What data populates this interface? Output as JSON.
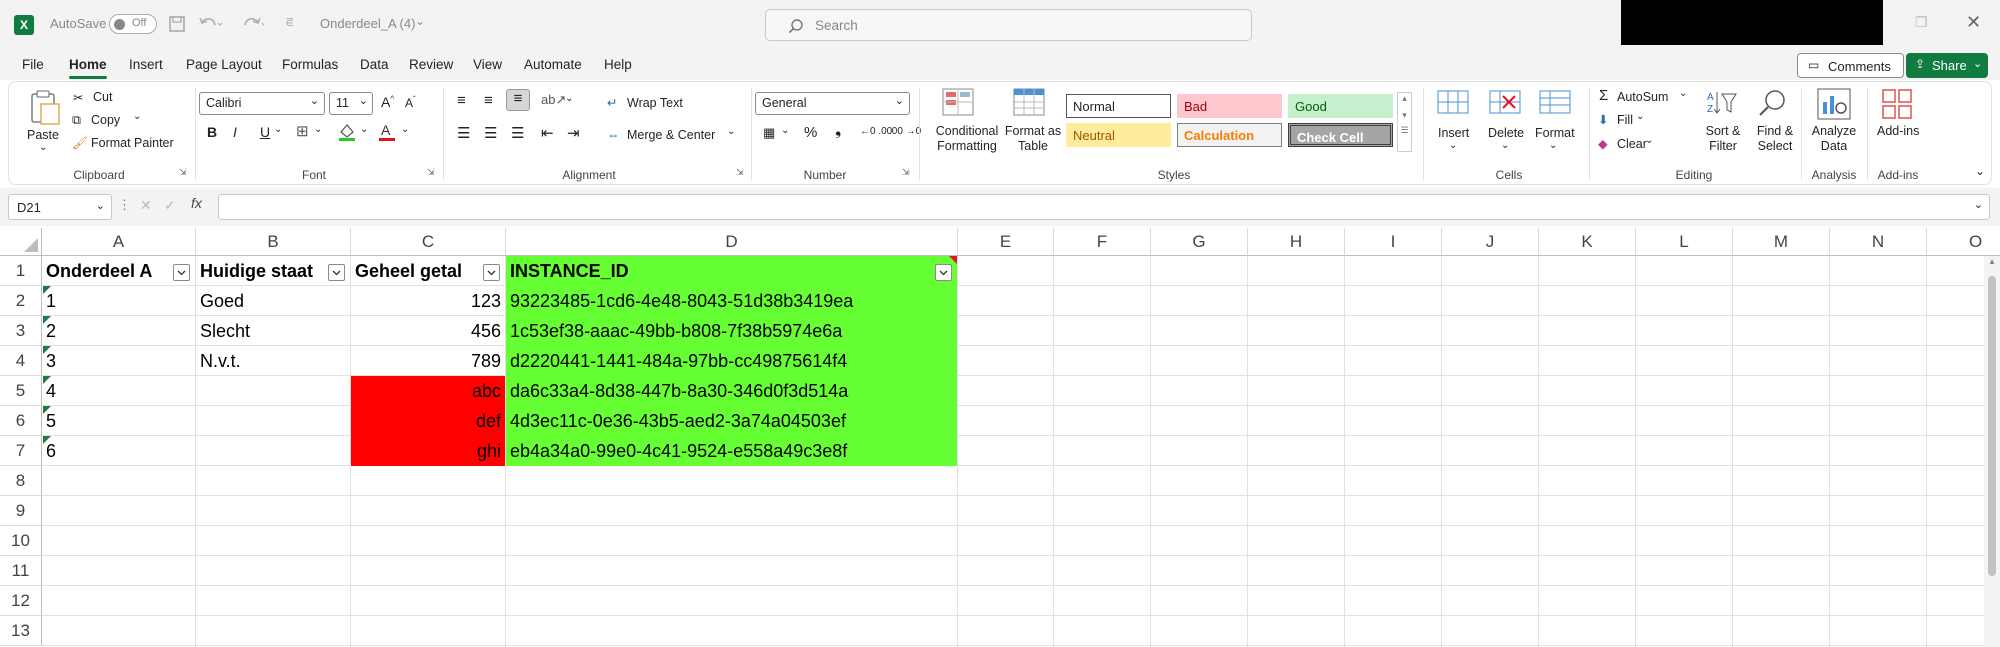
{
  "titlebar": {
    "autosave_label": "AutoSave",
    "autosave_state": "Off",
    "filename": "Onderdeel_A (4)",
    "search_placeholder": "Search"
  },
  "menu": {
    "tabs": [
      "File",
      "Home",
      "Insert",
      "Page Layout",
      "Formulas",
      "Data",
      "Review",
      "View",
      "Automate",
      "Help"
    ],
    "active": "Home",
    "comments_label": "Comments",
    "share_label": "Share"
  },
  "ribbon": {
    "clipboard": {
      "paste": "Paste",
      "cut": "Cut",
      "copy": "Copy",
      "format_painter": "Format Painter",
      "label": "Clipboard"
    },
    "font": {
      "family": "Calibri",
      "size": "11",
      "bold": "B",
      "italic": "I",
      "underline": "U",
      "label": "Font"
    },
    "alignment": {
      "wrap": "Wrap Text",
      "merge": "Merge & Center",
      "label": "Alignment"
    },
    "number": {
      "format": "General",
      "label": "Number"
    },
    "styles": {
      "conditional": "Conditional Formatting",
      "format_table": "Format as Table",
      "normal": "Normal",
      "bad": "Bad",
      "good": "Good",
      "neutral": "Neutral",
      "calculation": "Calculation",
      "check_cell": "Check Cell",
      "label": "Styles"
    },
    "cells": {
      "insert": "Insert",
      "delete": "Delete",
      "format": "Format",
      "label": "Cells"
    },
    "editing": {
      "autosum": "AutoSum",
      "fill": "Fill",
      "clear": "Clear",
      "sort_filter": "Sort & Filter",
      "find_select": "Find & Select",
      "label": "Editing"
    },
    "analysis": {
      "analyze": "Analyze Data",
      "label": "Analysis"
    },
    "addins": {
      "addins": "Add-ins",
      "label": "Add-ins"
    }
  },
  "formula_bar": {
    "name_box": "D21",
    "fx": "fx",
    "content": ""
  },
  "sheet": {
    "columns": [
      "A",
      "B",
      "C",
      "D",
      "E",
      "F",
      "G",
      "H",
      "I",
      "J",
      "K",
      "L",
      "M",
      "N",
      "O"
    ],
    "rows": [
      "1",
      "2",
      "3",
      "4",
      "5",
      "6",
      "7",
      "8",
      "9",
      "10",
      "11",
      "12",
      "13"
    ],
    "headers": [
      "Onderdeel A",
      "Huidige staat",
      "Geheel getal",
      "INSTANCE_ID"
    ],
    "data": [
      [
        "1",
        "Goed",
        "123",
        "93223485-1cd6-4e48-8043-51d38b3419ea"
      ],
      [
        "2",
        "Slecht",
        "456",
        "1c53ef38-aaac-49bb-b808-7f38b5974e6a"
      ],
      [
        "3",
        "N.v.t.",
        "789",
        "d2220441-1441-484a-97bb-cc49875614f4"
      ],
      [
        "4",
        "",
        "abc",
        "da6c33a4-8d38-447b-8a30-346d0f3d514a"
      ],
      [
        "5",
        "",
        "def",
        "4d3ec11c-0e36-43b5-aed2-3a74a04503ef"
      ],
      [
        "6",
        "",
        "ghi",
        "eb4a34a0-99e0-4c41-9524-e558a49c3e8f"
      ]
    ],
    "colors": {
      "green_fill": "#66ff33",
      "red_fill": "#ff0000",
      "excel_green": "#107c41"
    }
  }
}
